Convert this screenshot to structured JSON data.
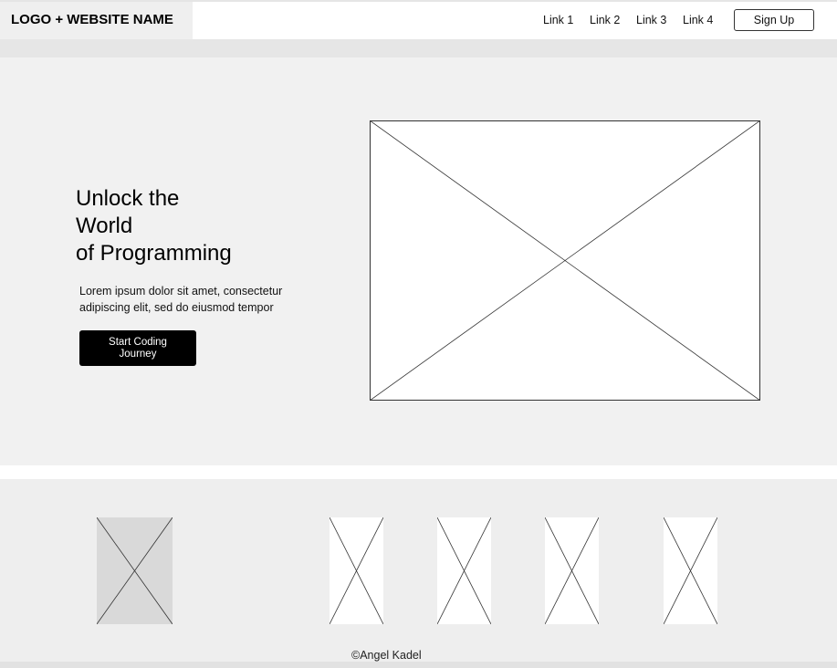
{
  "header": {
    "logo_text": "LOGO + WEBSITE NAME",
    "nav_links": [
      "Link 1",
      "Link 2",
      "Link 3",
      "Link 4"
    ],
    "signup_label": "Sign Up"
  },
  "hero": {
    "title_lines": [
      "Unlock the",
      "World",
      "of Programming"
    ],
    "description_lines": [
      "Lorem ipsum dolor sit amet, consectetur",
      "adipiscing elit, sed do eiusmod tempor"
    ],
    "cta_lines": [
      "Start Coding",
      "Journey"
    ],
    "image_icon": "image-placeholder-icon"
  },
  "gallery": {
    "placeholder_icon": "image-placeholder-icon",
    "colors": {
      "first": "#d9d9d9",
      "rest": "#ffffff"
    }
  },
  "footer": {
    "copyright": "©Angel Kadel"
  }
}
